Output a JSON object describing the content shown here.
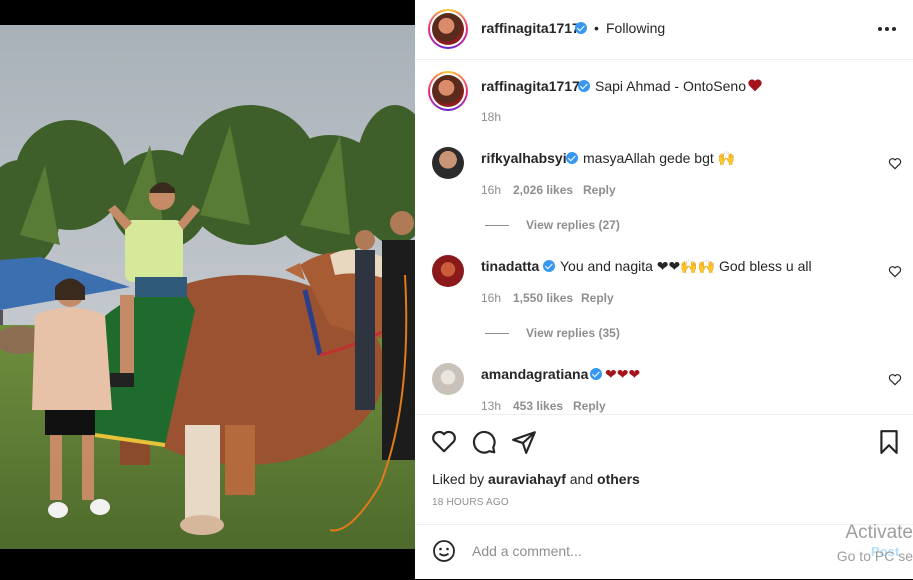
{
  "post": {
    "author": "raffinagita1717",
    "follow_status": "Following",
    "separator": "•",
    "caption": "Sapi Ahmad - OntoSeno",
    "caption_time": "18h",
    "liked_by_prefix": "Liked by",
    "liked_by_user": "auraviahayf",
    "liked_by_and": "and",
    "liked_by_others": "others",
    "time_ago": "18 HOURS AGO"
  },
  "comments": [
    {
      "user": "rifkyalhabsyi",
      "text": "masyaAllah gede bgt 🙌",
      "time": "16h",
      "likes": "2,026 likes",
      "reply": "Reply",
      "view_replies": "View replies (27)"
    },
    {
      "user": "tinadatta",
      "text": "You and nagita ❤❤🙌🙌 God bless u all",
      "time": "16h",
      "likes": "1,550 likes",
      "reply": "Reply",
      "view_replies": "View replies (35)"
    },
    {
      "user": "amandagratiana",
      "text": "❤❤❤",
      "time": "13h",
      "likes": "453 likes",
      "reply": "Reply"
    }
  ],
  "add_comment": {
    "placeholder": "Add a comment...",
    "post_label": "Post"
  },
  "watermark": {
    "line1": "Activate",
    "line2": "Go to PC se"
  },
  "icons": {
    "more": "more-horizontal-icon",
    "like": "heart-icon",
    "comment": "comment-bubble-icon",
    "share": "paper-plane-icon",
    "save": "bookmark-icon",
    "emoji": "emoji-icon",
    "verified": "verified-badge-icon"
  },
  "colors": {
    "verified": "#3897f0",
    "heart": "#a3141c",
    "muted": "#8e8e8e",
    "post_button": "#b2dffc"
  }
}
